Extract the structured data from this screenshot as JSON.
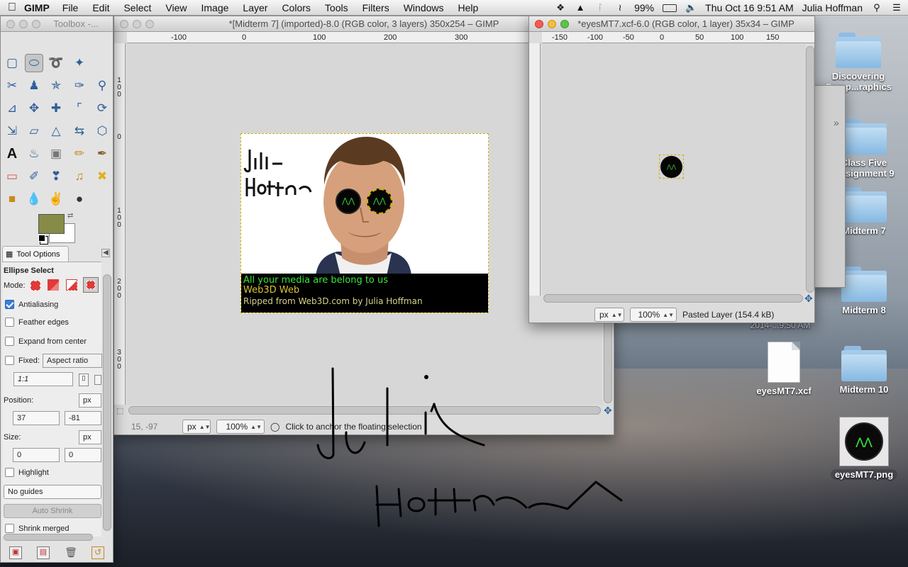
{
  "menubar": {
    "app_name": "GIMP",
    "items": [
      "File",
      "Edit",
      "Select",
      "View",
      "Image",
      "Layer",
      "Colors",
      "Tools",
      "Filters",
      "Windows",
      "Help"
    ],
    "battery": "99%",
    "clock": "Thu Oct 16  9:51 AM",
    "user": "Julia Hoffman"
  },
  "toolbox": {
    "title": "Toolbox -...",
    "fg_color": "#868c47",
    "bg_color": "#ffffff",
    "tool_options_tab": "Tool Options",
    "tool_name": "Ellipse Select",
    "mode_label": "Mode:",
    "antialiasing": "Antialiasing",
    "feather_edges": "Feather edges",
    "expand_from_center": "Expand from center",
    "fixed_label": "Fixed:",
    "fixed_value": "Aspect ratio",
    "ratio_value": "1:1",
    "position_label": "Position:",
    "position_unit": "px",
    "position_x": "37",
    "position_y": "-81",
    "size_label": "Size:",
    "size_unit": "px",
    "size_w": "0",
    "size_h": "0",
    "highlight": "Highlight",
    "guides": "No guides",
    "auto_shrink": "Auto Shrink",
    "shrink_merged": "Shrink merged"
  },
  "main_window": {
    "title": "*[Midterm 7] (imported)-8.0 (RGB color, 3 layers) 350x254 – GIMP",
    "ruler_labels": [
      "-100",
      "0",
      "100",
      "200",
      "300"
    ],
    "vruler_labels": [
      "1",
      "0",
      "0",
      "0",
      "1",
      "0",
      "0",
      "2",
      "0",
      "0",
      "3",
      "0",
      "0"
    ],
    "coords": "15, -97",
    "unit": "px",
    "zoom": "100%",
    "status": "Click to anchor the floating selection",
    "banner_line1": "All your media are belong to us",
    "banner_line2": "Web3D Web",
    "banner_line3": "Ripped from Web3D.com by Julia Hoffman"
  },
  "second_window": {
    "title": "*eyesMT7.xcf-6.0 (RGB color, 1 layer) 35x34 – GIMP",
    "ruler_labels": [
      "-150",
      "-100",
      "-50",
      "0",
      "50",
      "100",
      "150"
    ],
    "unit": "px",
    "zoom": "100%",
    "status": "Pasted Layer (154.4 kB)"
  },
  "desktop": {
    "icons": [
      {
        "label": "Discovering",
        "label2": "Comp...raphics"
      },
      {
        "label": "Class Five",
        "label2": "Assignment 9"
      },
      {
        "label": "Midterm 7",
        "label2": ""
      },
      {
        "label": "Midterm 8",
        "label2": ""
      },
      {
        "label": "eyesMT7.xcf",
        "label2": ""
      },
      {
        "label": "Midterm 10",
        "label2": ""
      },
      {
        "label": "eyesMT7.png",
        "label2": ""
      }
    ],
    "hidden_date_label": "2014-...9:50 AM"
  }
}
